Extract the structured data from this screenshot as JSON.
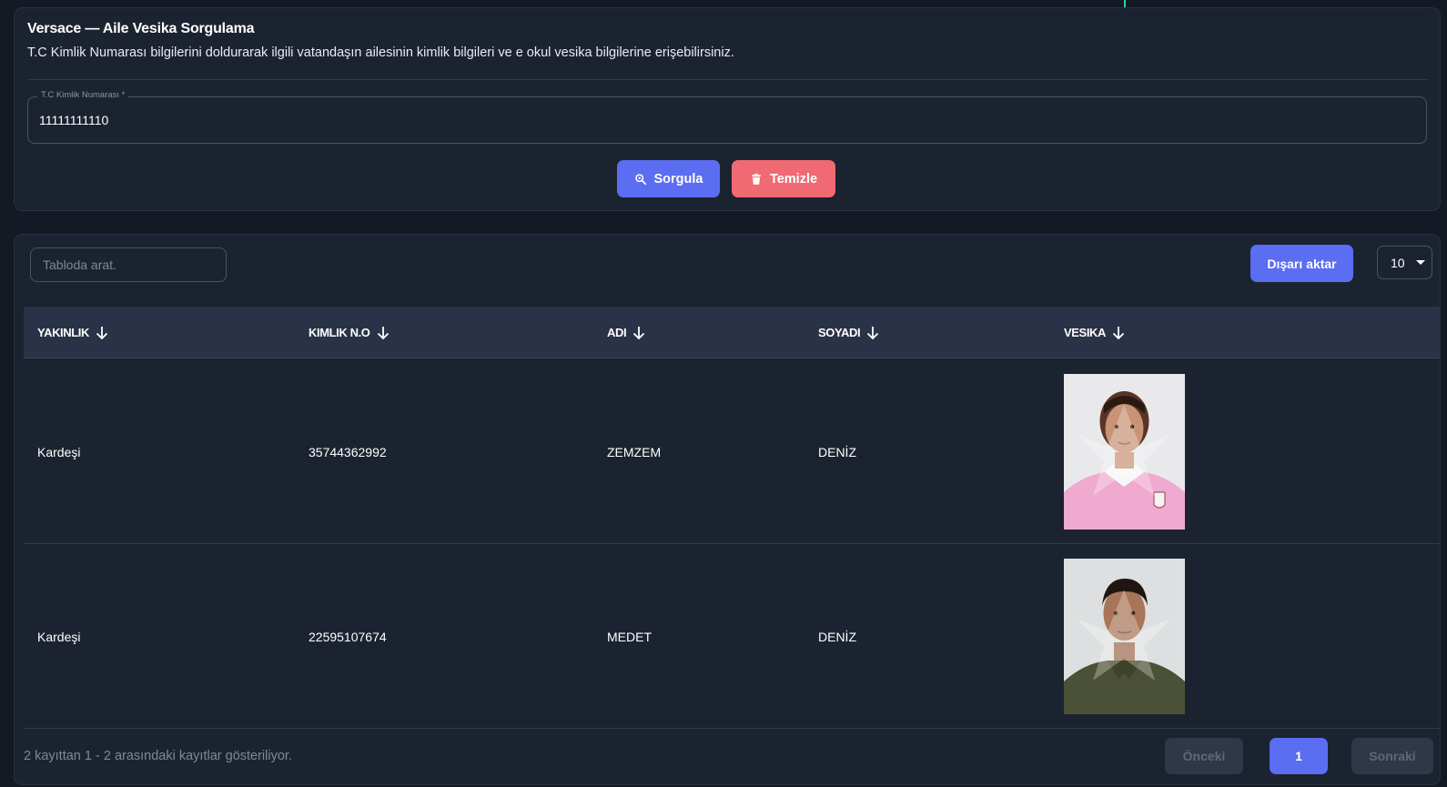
{
  "header": {
    "title": "Versace — Aile Vesika Sorgulama",
    "description": "T.C Kimlik Numarası bilgilerini doldurarak ilgili vatandaşın ailesinin kimlik bilgileri ve e okul vesika bilgilerine erişebilirsiniz."
  },
  "form": {
    "tc_label": "T.C Kimlik Numarası *",
    "tc_value": "11111111110",
    "search_label": "Sorgula",
    "clear_label": "Temizle"
  },
  "table": {
    "search_placeholder": "Tabloda arat.",
    "export_label": "Dışarı aktar",
    "page_size": "10",
    "columns": [
      "YAKINLIK",
      "KIMLIK N.O",
      "ADI",
      "SOYADI",
      "VESIKA"
    ],
    "rows": [
      {
        "yakinlik": "Kardeşi",
        "kimlik": "35744362992",
        "adi": "ZEMZEM",
        "soyadi": "DENİZ",
        "vesika": "photo-girl-pink-uniform"
      },
      {
        "yakinlik": "Kardeşi",
        "kimlik": "22595107674",
        "adi": "MEDET",
        "soyadi": "DENİZ",
        "vesika": "photo-boy-green-shirt"
      }
    ],
    "footer_info": "2 kayıttan 1 - 2 arasındaki kayıtlar gösteriliyor.",
    "pagination": {
      "prev": "Önceki",
      "current": "1",
      "next": "Sonraki"
    }
  },
  "colors": {
    "primary": "#5b6df0",
    "danger": "#f06a73",
    "background": "#141a24",
    "card": "#1c2330"
  }
}
